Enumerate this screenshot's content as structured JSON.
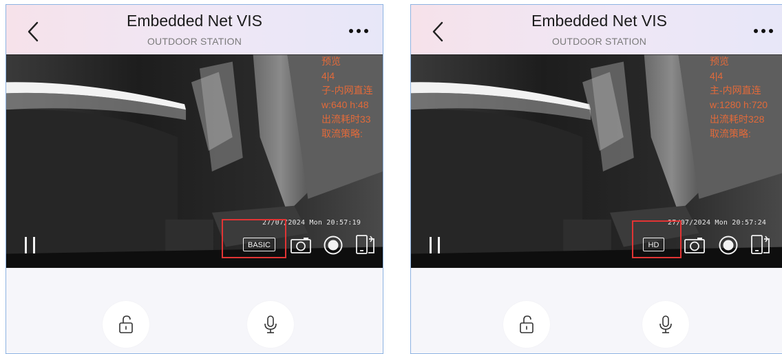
{
  "panels": [
    {
      "header": {
        "title": "Embedded Net VIS",
        "subtitle": "OUTDOOR STATION",
        "back_icon": "chevron-left-icon",
        "more_icon": "more-dots-icon"
      },
      "video": {
        "overlay_lines": [
          "预览",
          "4|4",
          "子-内网直连",
          "w:640 h:48",
          "出流耗时33",
          "取流策略:"
        ],
        "timestamp": "27/07/2024 Mon 20:57:19",
        "controls": {
          "pause_icon": "pause-icon",
          "quality_label": "BASIC",
          "camera_icon": "camera-icon",
          "record_icon": "record-icon",
          "screen_icon": "screen-rotate-icon"
        }
      },
      "bottom": {
        "unlock_icon": "unlock-icon",
        "mic_icon": "microphone-icon"
      }
    },
    {
      "header": {
        "title": "Embedded Net VIS",
        "subtitle": "OUTDOOR STATION",
        "back_icon": "chevron-left-icon",
        "more_icon": "more-dots-icon"
      },
      "video": {
        "overlay_lines": [
          "预览",
          "4|4",
          "主-内网直连",
          "w:1280 h:720",
          "出流耗时328",
          "取流策略:"
        ],
        "timestamp": "27/07/2024 Mon 20:57:24",
        "controls": {
          "pause_icon": "pause-icon",
          "quality_label": "HD",
          "camera_icon": "camera-icon",
          "record_icon": "record-icon",
          "screen_icon": "screen-rotate-icon"
        }
      },
      "bottom": {
        "unlock_icon": "unlock-icon",
        "mic_icon": "microphone-icon"
      }
    }
  ],
  "colors": {
    "overlay_text": "#e26a3a",
    "highlight_border": "#e23434",
    "panel_border": "#8db3e2"
  }
}
